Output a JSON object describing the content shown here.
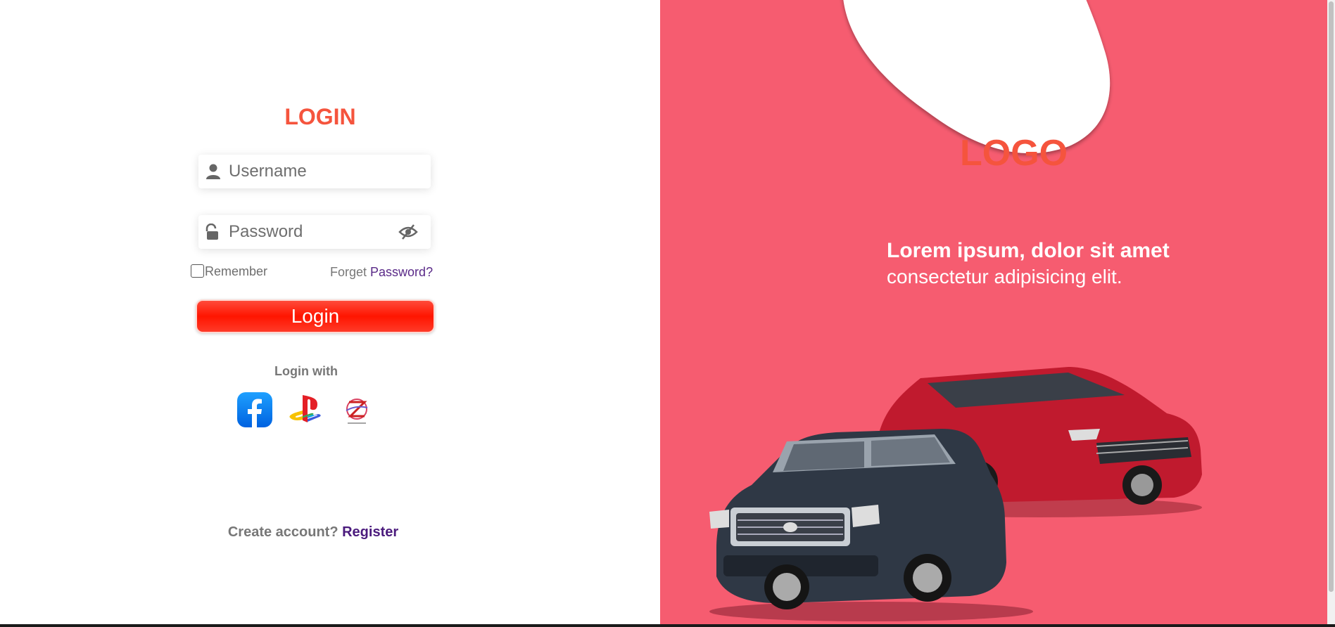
{
  "login": {
    "title": "LOGIN",
    "username_placeholder": "Username",
    "password_placeholder": "Password",
    "remember_label": "Remember",
    "forget_prefix": "Forget ",
    "forget_link": "Password?",
    "login_button": "Login",
    "login_with": "Login with",
    "social": [
      {
        "name": "facebook-icon"
      },
      {
        "name": "playstation-icon"
      },
      {
        "name": "epic-icon"
      }
    ],
    "create_prefix": "Create account? ",
    "register_link": "Register"
  },
  "brand": {
    "logo": "LOGO",
    "heading": "Lorem ipsum, dolor sit amet",
    "subheading": "consectetur adipisicing elit."
  },
  "colors": {
    "accent": "#f5543d",
    "panel": "#f65c70",
    "button": "#ff1500",
    "link": "#5a2a88"
  }
}
